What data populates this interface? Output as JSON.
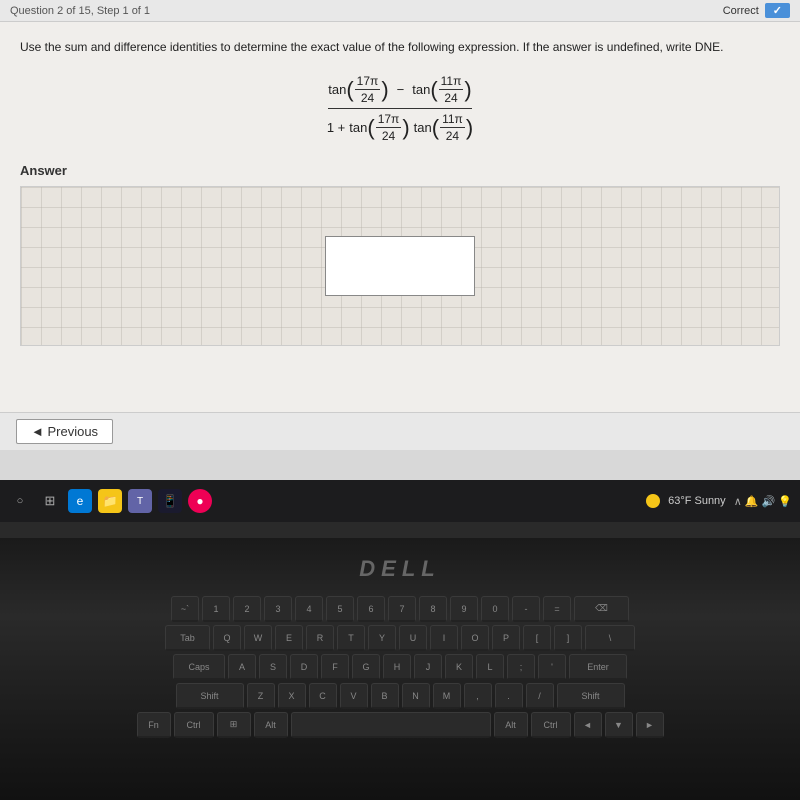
{
  "header": {
    "question_label": "Question 2 of 15, Step 1 of 1",
    "status_text": "Correct"
  },
  "question": {
    "instruction": "Use the sum and difference identities to determine the exact value of the following expression. If the answer is undefined, write DNE.",
    "formula": {
      "numerator": "tan(17π/24) − tan(11π/24)",
      "denominator": "1 + tan(17π/24)tan(11π/24)",
      "num_tan1_num": "17π",
      "num_tan1_den": "24",
      "num_tan2_num": "11π",
      "num_tan2_den": "24",
      "den_tan1_num": "17π",
      "den_tan1_den": "24",
      "den_tan2_num": "11π",
      "den_tan2_den": "24"
    }
  },
  "answer": {
    "label": "Answer"
  },
  "buttons": {
    "previous": "◄ Previous"
  },
  "taskbar": {
    "weather": "63°F Sunny",
    "time": ""
  },
  "dell_logo": "DØLL",
  "keyboard": {
    "row1": [
      "~`",
      "!1",
      "@2",
      "#3",
      "$4",
      "%5",
      "^6",
      "&7",
      "*8",
      "(9",
      ")0",
      "_-",
      "+=",
      "⌫"
    ],
    "row2": [
      "Tab",
      "Q",
      "W",
      "E",
      "R",
      "T",
      "Y",
      "U",
      "I",
      "O",
      "P",
      "{[",
      "]}",
      "\\|"
    ],
    "row3": [
      "Caps",
      "A",
      "S",
      "D",
      "F",
      "G",
      "H",
      "J",
      "K",
      "L",
      ":;",
      "\"'",
      "Enter"
    ],
    "row4": [
      "Shift",
      "Z",
      "X",
      "C",
      "V",
      "B",
      "N",
      "M",
      "<,",
      ">.",
      "?/",
      "Shift"
    ],
    "row5": [
      "Fn",
      "Ctrl",
      "Win",
      "Alt",
      "",
      "Alt",
      "Ctrl",
      "◄",
      "▼",
      "►"
    ]
  }
}
